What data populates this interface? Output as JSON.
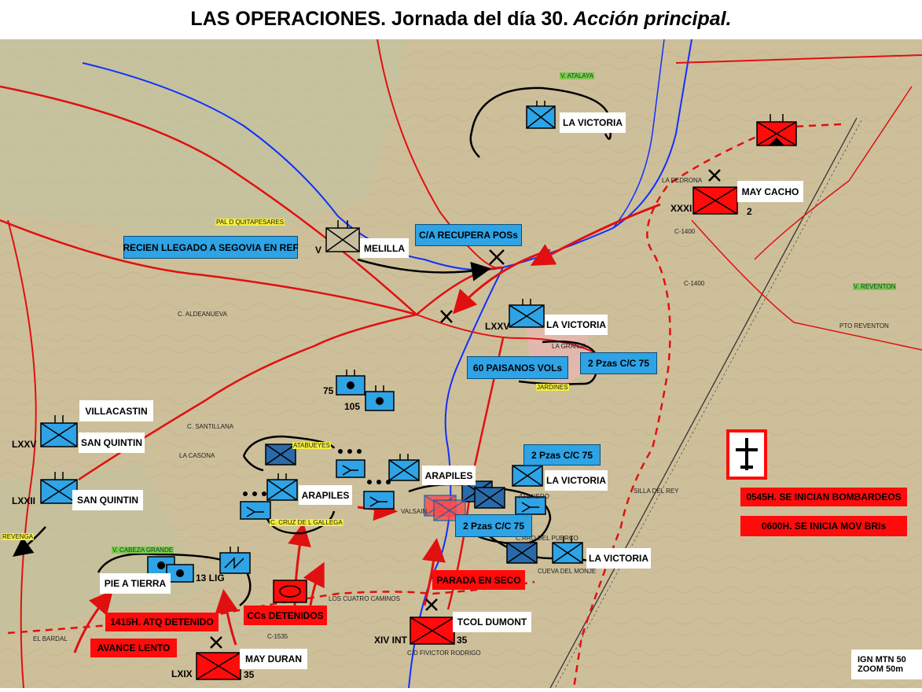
{
  "title": {
    "part1": "LAS OPERACIONES.",
    "part2": " Jornada del día 30.",
    "part3": " Acción principal."
  },
  "colors": {
    "friendly": "#2ea3e6",
    "friendly_dark": "#2a6aa8",
    "enemy": "#ff0b0b",
    "river": "#1030ff",
    "road": "#e01010"
  },
  "labels": {
    "recien": "RECIEN LLEGADO A SEGOVIA EN REF",
    "recupera": "C/A RECUPERA POSs",
    "paisanos": "60 PAISANOS VOLs",
    "pzas1": "2 Pzas C/C 75",
    "pzas2": "2 Pzas C/C 75",
    "pzas3": "2 Pzas C/C 75",
    "bomb": "0545H. SE INICIAN BOMBARDEOS",
    "mov": "0600H. SE INICIA MOV BRIs",
    "parada": "PARADA EN SECO",
    "ccs": "CCs DETENIDOS",
    "atq": "1415H. ATQ DETENIDO",
    "avance": "AVANCE LENTO",
    "pie": "PIE A TIERRA",
    "villacastin": "VILLACASTIN",
    "sq1": "SAN QUINTIN",
    "sq2": "SAN QUINTIN",
    "lv1": "LA VICTORIA",
    "lv2": "LA VICTORIA",
    "lv3": "LA VICTORIA",
    "lv4": "LA VICTORIA",
    "arapiles1": "ARAPILES",
    "arapiles2": "ARAPILES",
    "melilla": "MELILLA",
    "may_cacho": "MAY CACHO",
    "tcol": "TCOL DUMONT",
    "may_duran": "MAY DURAN",
    "lig": "13 LIG",
    "v": "V",
    "lxxv_a": "LXXV",
    "lxxv_b": "LXXV",
    "lxxii": "LXXII",
    "xxxi": "XXXI",
    "xiv": "XIV INT",
    "lxix": "LXIX",
    "n75": "75",
    "n105": "105",
    "n2": "2",
    "n35a": "35",
    "n35b": "35",
    "ign1": "IGN MTN 50",
    "ign2": "ZOOM 50m"
  },
  "places": {
    "atalaya": "V. ATALAYA",
    "pedrona": "LA PEDRONA",
    "quitapesares": "PAL D QUITAPESARES",
    "aldeanueva": "C. ALDEANUEVA",
    "granja": "LA GRANJA",
    "jardines": "JARDINES",
    "santillana": "C. SANTILLANA",
    "casona": "LA CASONA",
    "atabueyes": "ATABUEYES",
    "cruz": "C. CRUZ DE L GALLEGA",
    "cabeza": "V. CABEZA GRANDE",
    "revenga": "REVENGA",
    "cuatro": "LOS CUATRO CAMINOS",
    "bardal": "EL BARDAL",
    "fivictor": "C.D FIVICTOR RODRIGO",
    "valsain": "VALSAIN",
    "puerco": "C.RRO DEL PUERCO",
    "monje": "CUEVA DEL MONJE",
    "silla": "SILLA DEL REY",
    "reventon": "V. REVENTON",
    "pto_reventon": "PTO REVENTON",
    "c1400a": "C-1400",
    "c1400b": "C-1400",
    "c1535": "C-1535",
    "atoner": "ATONERO"
  },
  "icons": {
    "friendly_unit": "infantry-unit-icon",
    "aircraft": "aircraft-icon",
    "destroyed": "destroyed-cross-icon"
  }
}
